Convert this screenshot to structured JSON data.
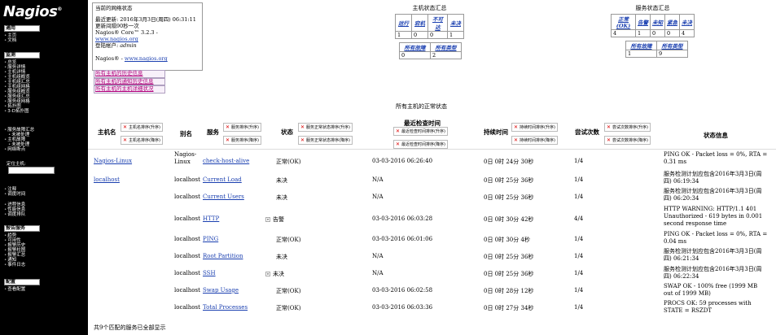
{
  "sidebar": {
    "logo": "Nagios",
    "logo_mark": "®",
    "sections": [
      {
        "title": "通用",
        "items": [
          "主页",
          "文档"
        ]
      },
      {
        "title": "监测",
        "items": [
          "总览",
          "服务详情",
          "主机详情",
          "主机组概览",
          "主机组汇总",
          "主机组网格",
          "服务组概览",
          "服务组汇总",
          "服务组网格",
          "拓扑图",
          "3-D拓扑图"
        ]
      },
      {
        "title": "",
        "items": [
          "服务故障汇总",
          "未被处理",
          "主机故障",
          "未被处理",
          "网络断点"
        ]
      },
      {
        "title": "",
        "items": [
          "注释",
          "调度时间"
        ]
      },
      {
        "title": "",
        "items": [
          "进程信息",
          "性能信息",
          "调度排队"
        ]
      },
      {
        "title": "报告服务",
        "items": [
          "趋势",
          "可用性",
          "报警历史",
          "报警柱图",
          "报警汇总",
          "通知",
          "事件日志"
        ]
      },
      {
        "title": "配置",
        "items": [
          "查看配置"
        ]
      }
    ],
    "search_label": "定位主机:",
    "search_value": ""
  },
  "info": {
    "title": "当前的网络状态",
    "last_updated": "最近更新: 2016年3月3日(周四) 06:31:11",
    "refresh": "更新间隔90秒一次",
    "version_prefix": "Nagios® Core™ 3.2.3 - ",
    "version_link": "www.nagios.org",
    "user_prefix": "登陆帐户: ",
    "user": "admin",
    "nagios_prefix": "Nagios® - ",
    "nagios_link": "www.nagios.org"
  },
  "history_links": [
    "所有主机的历史信息",
    "所有主机的通知历史信息",
    "所有主机的主机详细状况"
  ],
  "host_totals": {
    "title": "主机状态汇总",
    "headers": [
      "运行",
      "宕机",
      "不可达",
      "未决"
    ],
    "values": [
      "1",
      "0",
      "0",
      "1"
    ],
    "sub_headers": [
      "所有故障",
      "所有类型"
    ],
    "sub_values": [
      "0",
      "2"
    ]
  },
  "service_totals": {
    "title": "服务状态汇总",
    "headers": [
      "正常(OK)",
      "告警",
      "未知",
      "紧急",
      "未决"
    ],
    "values": [
      "4",
      "1",
      "0",
      "0",
      "4"
    ],
    "sub_headers": [
      "所有故障",
      "所有类型"
    ],
    "sub_values": [
      "1",
      "9"
    ]
  },
  "caption": "所有主机的正常状态",
  "columns": {
    "host": "主机名",
    "alias": "别名",
    "service": "服务",
    "status": "状态",
    "last_check": "最近检查时间",
    "duration": "持续时间",
    "attempts": "尝试次数",
    "info": "状态信息"
  },
  "sort_labels": {
    "host_asc": "主机名排序(升序)",
    "host_desc": "主机名排序(降序)",
    "svc_asc": "服务排序(升序)",
    "svc_desc": "服务排序(降序)",
    "status_asc": "服务正常状态排序(升序)",
    "status_desc": "服务正常状态排序(降序)",
    "check_asc": "最近检查时间排序(升序)",
    "check_desc": "最近检查时间排序(降序)",
    "dur_asc": "持续时间排序(升序)",
    "dur_desc": "持续时间排序(降序)",
    "att_asc": "尝试次数排序(升序)",
    "att_desc": "尝试次数排序(降序)"
  },
  "rows": [
    {
      "host": "Nagios-Linux",
      "alias": "Nagios-Linux",
      "service": "check-host-alive",
      "status": "正常(OK)",
      "last_check": "03-03-2016 06:26:40",
      "duration": "0日 0时 24分 30秒",
      "attempts": "1/4",
      "info": "PING OK - Packet loss = 0%, RTA = 0.31 ms",
      "icon": false
    },
    {
      "host": "localhost",
      "alias": "localhost",
      "service": "Current Load",
      "status": "未决",
      "last_check": "N/A",
      "duration": "0日 0时 25分 36秒",
      "attempts": "1/4",
      "info": "服务检测计划应包含2016年3月3日(周四) 06:19:34",
      "icon": false
    },
    {
      "host": "",
      "alias": "localhost",
      "service": "Current Users",
      "status": "未决",
      "last_check": "N/A",
      "duration": "0日 0时 25分 36秒",
      "attempts": "1/4",
      "info": "服务检测计划应包含2016年3月3日(周四) 06:20:34",
      "icon": false
    },
    {
      "host": "",
      "alias": "localhost",
      "service": "HTTP",
      "status": "告警",
      "last_check": "03-03-2016 06:03:28",
      "duration": "0日 0时 30分 42秒",
      "attempts": "4/4",
      "info": "HTTP WARNING: HTTP/1.1 401 Unauthorized - 619 bytes in 0.001 second response time",
      "icon": true
    },
    {
      "host": "",
      "alias": "localhost",
      "service": "PING",
      "status": "正常(OK)",
      "last_check": "03-03-2016 06:01:06",
      "duration": "0日 0时 30分 4秒",
      "attempts": "1/4",
      "info": "PING OK - Packet loss = 0%, RTA = 0.04 ms",
      "icon": false
    },
    {
      "host": "",
      "alias": "localhost",
      "service": "Root Partition",
      "status": "未决",
      "last_check": "N/A",
      "duration": "0日 0时 25分 36秒",
      "attempts": "1/4",
      "info": "服务检测计划应包含2016年3月3日(周四) 06:21:34",
      "icon": false
    },
    {
      "host": "",
      "alias": "localhost",
      "service": "SSH",
      "status": "未决",
      "last_check": "N/A",
      "duration": "0日 0时 25分 36秒",
      "attempts": "1/4",
      "info": "服务检测计划应包含2016年3月3日(周四) 06:22:34",
      "icon": true
    },
    {
      "host": "",
      "alias": "localhost",
      "service": "Swap Usage",
      "status": "正常(OK)",
      "last_check": "03-03-2016 06:02:58",
      "duration": "0日 0时 28分 12秒",
      "attempts": "1/4",
      "info": "SWAP OK - 100% free (1999 MB out of 1999 MB)",
      "icon": false
    },
    {
      "host": "",
      "alias": "localhost",
      "service": "Total Processes",
      "status": "正常(OK)",
      "last_check": "03-03-2016 06:03:36",
      "duration": "0日 0时 27分 34秒",
      "attempts": "1/4",
      "info": "PROCS OK: 59 processes with STATE = RSZDT",
      "icon": false
    }
  ],
  "footer": "共9个匹配的服务已全部显示"
}
